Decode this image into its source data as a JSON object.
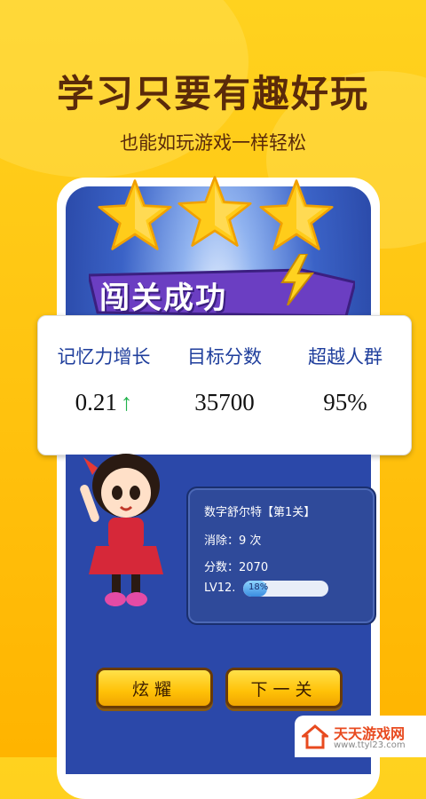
{
  "headline": "学习只要有趣好玩",
  "subheadline": "也能如玩游戏一样轻松",
  "banner": {
    "text": "闯关成功"
  },
  "stats": [
    {
      "label": "记忆力增长",
      "value": "0.21",
      "trend": "up"
    },
    {
      "label": "目标分数",
      "value": "35700"
    },
    {
      "label": "超越人群",
      "value": "95%"
    }
  ],
  "level_info": {
    "title": "数字舒尔特【第1关】",
    "eliminated": "消除：9 次",
    "score": "分数：2070",
    "level_label": "LV12.",
    "progress_text": "18%",
    "progress": 0.18
  },
  "buttons": {
    "show_off": "炫耀",
    "next": "下一关"
  },
  "watermark": {
    "title": "天天游戏网",
    "url": "www.ttyl23.com"
  },
  "colors": {
    "accent_yellow": "#ffc20e",
    "panel_blue": "#2b48a9",
    "label_blue": "#1f3e9c",
    "trend_green": "#1fb24a"
  }
}
